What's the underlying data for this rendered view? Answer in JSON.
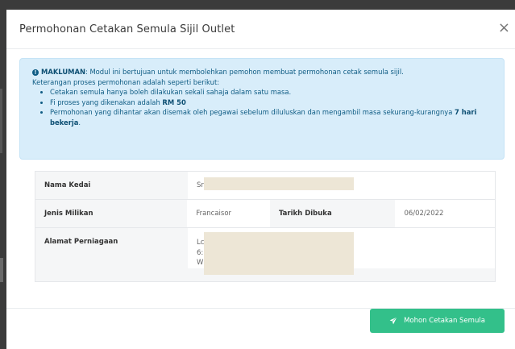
{
  "modal": {
    "title": "Permohonan Cetakan Semula Sijil Outlet",
    "close_glyph": "×"
  },
  "notice": {
    "icon": "info-circle-icon",
    "heading": "MAKLUMAN",
    "intro": ": Modul ini bertujuan untuk membolehkan pemohon membuat permohonan cetak semula sijil.",
    "line2": "Keterangan proses permohonan adalah seperti berikut:",
    "bullet1": "Cetakan semula hanya boleh dilakukan sekali sahaja dalam satu masa.",
    "bullet2_prefix": "Fi proses yang dikenakan adalah ",
    "bullet2_bold": "RM 50",
    "bullet3_prefix": "Permohonan yang dihantar akan disemak oleh pegawai sebelum diluluskan dan mengambil masa sekurang-kurangnya ",
    "bullet3_bold": "7 hari bekerja",
    "bullet3_suffix": "."
  },
  "details": {
    "shop_name_label": "Nama Kedai",
    "shop_name_value": "Sr",
    "ownership_label": "Jenis Milikan",
    "ownership_value": "Francaisor",
    "open_date_label": "Tarikh Dibuka",
    "open_date_value": "06/02/2022",
    "address_label": "Alamat Perniagaan",
    "address_lines": [
      "Lc",
      "6:",
      "W"
    ]
  },
  "footer": {
    "submit_label": "Mohon Cetakan Semula",
    "submit_icon": "send-icon"
  },
  "colors": {
    "alert_bg": "#d8edfa",
    "alert_text": "#0f5c84",
    "primary_button": "#33c08a"
  }
}
